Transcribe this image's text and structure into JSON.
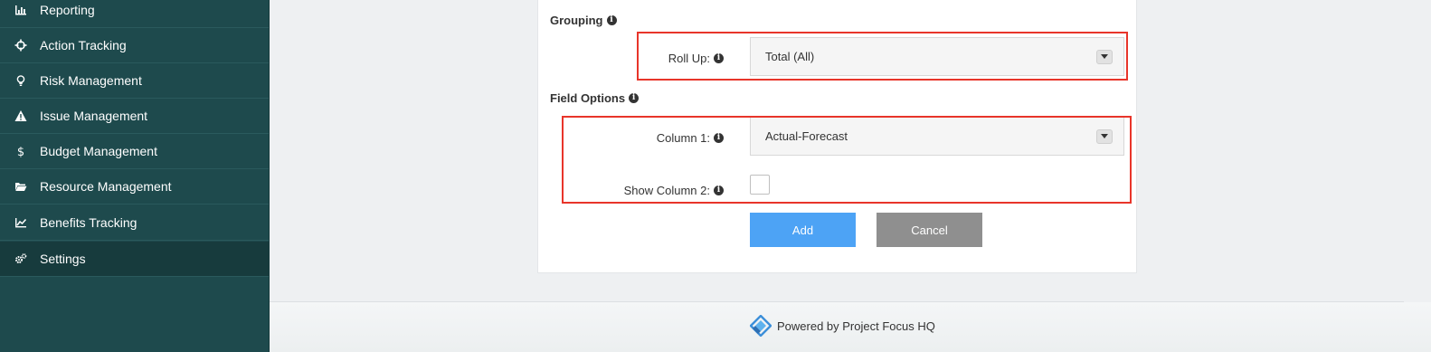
{
  "sidebar": {
    "items": [
      {
        "label": "Reporting",
        "icon": "bar-chart-icon"
      },
      {
        "label": "Action Tracking",
        "icon": "crosshair-icon"
      },
      {
        "label": "Risk Management",
        "icon": "lightbulb-icon"
      },
      {
        "label": "Issue Management",
        "icon": "warning-icon"
      },
      {
        "label": "Budget Management",
        "icon": "dollar-icon"
      },
      {
        "label": "Resource Management",
        "icon": "folder-open-icon"
      },
      {
        "label": "Benefits Tracking",
        "icon": "line-chart-icon"
      },
      {
        "label": "Settings",
        "icon": "gears-icon",
        "active": true
      }
    ]
  },
  "form": {
    "grouping_title": "Grouping",
    "rollup_label": "Roll Up:",
    "rollup_value": "Total (All)",
    "field_options_title": "Field Options",
    "column1_label": "Column 1:",
    "column1_value": "Actual-Forecast",
    "show_column2_label": "Show Column 2:",
    "show_column2_checked": false,
    "add_label": "Add",
    "cancel_label": "Cancel"
  },
  "footer": {
    "text": "Powered by Project Focus HQ"
  },
  "colors": {
    "sidebar_bg": "#1e4a4d",
    "highlight": "#e8352a",
    "add_button": "#4da3f5",
    "cancel_button": "#8f8f8f"
  }
}
